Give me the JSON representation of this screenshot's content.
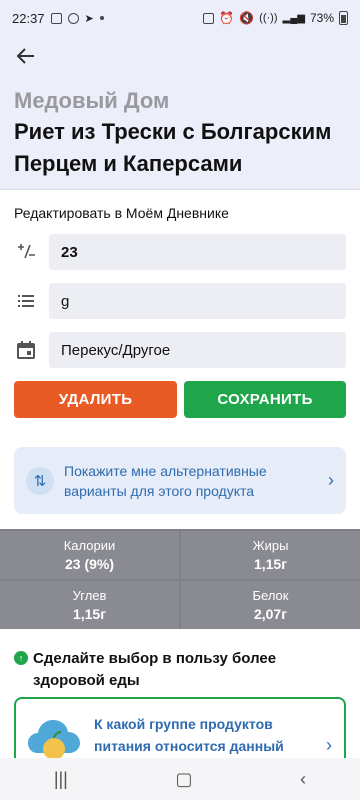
{
  "status": {
    "time": "22:37",
    "battery": "73%"
  },
  "header": {
    "brand": "Медовый Дом",
    "title": "Риет из Трески с Болгарским Перцем и Каперсами"
  },
  "edit": {
    "label": "Редактировать в Моём Дневнике"
  },
  "fields": {
    "quantity": {
      "icon": "plus-minus-icon",
      "value": "23"
    },
    "unit": {
      "icon": "list-icon",
      "value": "g"
    },
    "meal": {
      "icon": "calendar-icon",
      "value": "Перекус/Другое"
    }
  },
  "buttons": {
    "delete": "УДАЛИТЬ",
    "save": "СОХРАНИТЬ"
  },
  "colors": {
    "delete": "#e85b24",
    "save": "#1fa64a",
    "link": "#2f6bb0",
    "header_bg": "#eceef9",
    "nutrition_bg": "#8a8b92"
  },
  "alternatives": {
    "text": "Покажите мне альтернативные варианты для этого продукта"
  },
  "nutrition": [
    {
      "label": "Калории",
      "value": "23 (9%)"
    },
    {
      "label": "Жиры",
      "value": "1,15г"
    },
    {
      "label": "Углев",
      "value": "1,15г"
    },
    {
      "label": "Белок",
      "value": "2,07г"
    }
  ],
  "healthy": {
    "text": "Сделайте выбор в пользу более здоровой еды"
  },
  "food_group": {
    "text": "К какой группе продуктов питания относится данный"
  }
}
